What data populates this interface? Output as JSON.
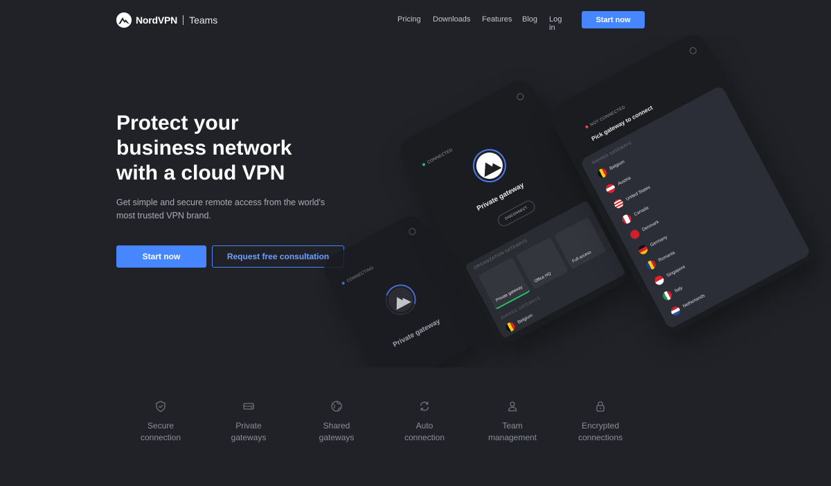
{
  "header": {
    "brand": "NordVPN",
    "brand_sub": "Teams",
    "nav": [
      "Pricing",
      "Downloads",
      "Features",
      "Blog",
      "Log in"
    ],
    "cta": "Start now"
  },
  "hero": {
    "title_lines": [
      "Protect your",
      "business network",
      "with a cloud VPN"
    ],
    "subtitle_lines": [
      "Get simple and secure remote access from the world's",
      "most trusted VPN brand."
    ],
    "primary_button": "Start now",
    "secondary_button": "Request free consultation"
  },
  "illustration": {
    "phone_connecting": {
      "status": "CONNECTING",
      "title": "Private gateway"
    },
    "phone_connected": {
      "status": "CONNECTED",
      "title": "Private gateway",
      "button": "DISCONNECT",
      "section": "ORGANIZATION GATEWAYS",
      "cards": [
        "Private gateway",
        "Office HQ",
        "Full access"
      ],
      "section2": "SHARED GATEWAYS",
      "list": [
        "Belgium"
      ]
    },
    "phone_list": {
      "status": "NOT CONNECTED",
      "title": "Pick gateway to connect",
      "section": "SHARED GATEWAYS",
      "countries": [
        "Belgium",
        "Austria",
        "United States",
        "Canada",
        "Denmark",
        "Germany",
        "Romania",
        "Singapore",
        "Italy",
        "Netherlands"
      ]
    }
  },
  "features": [
    {
      "icon": "shield-icon",
      "lines": [
        "Secure",
        "connection"
      ]
    },
    {
      "icon": "server-icon",
      "lines": [
        "Private",
        "gateways"
      ]
    },
    {
      "icon": "globe-icon",
      "lines": [
        "Shared",
        "gateways"
      ]
    },
    {
      "icon": "refresh-icon",
      "lines": [
        "Auto",
        "connection"
      ]
    },
    {
      "icon": "user-icon",
      "lines": [
        "Team",
        "management"
      ]
    },
    {
      "icon": "lock-icon",
      "lines": [
        "Encrypted",
        "connections"
      ]
    }
  ],
  "colors": {
    "background": "#212227",
    "accent": "#4687ff",
    "connected": "#26c36b",
    "not_connected": "#e5484d"
  }
}
